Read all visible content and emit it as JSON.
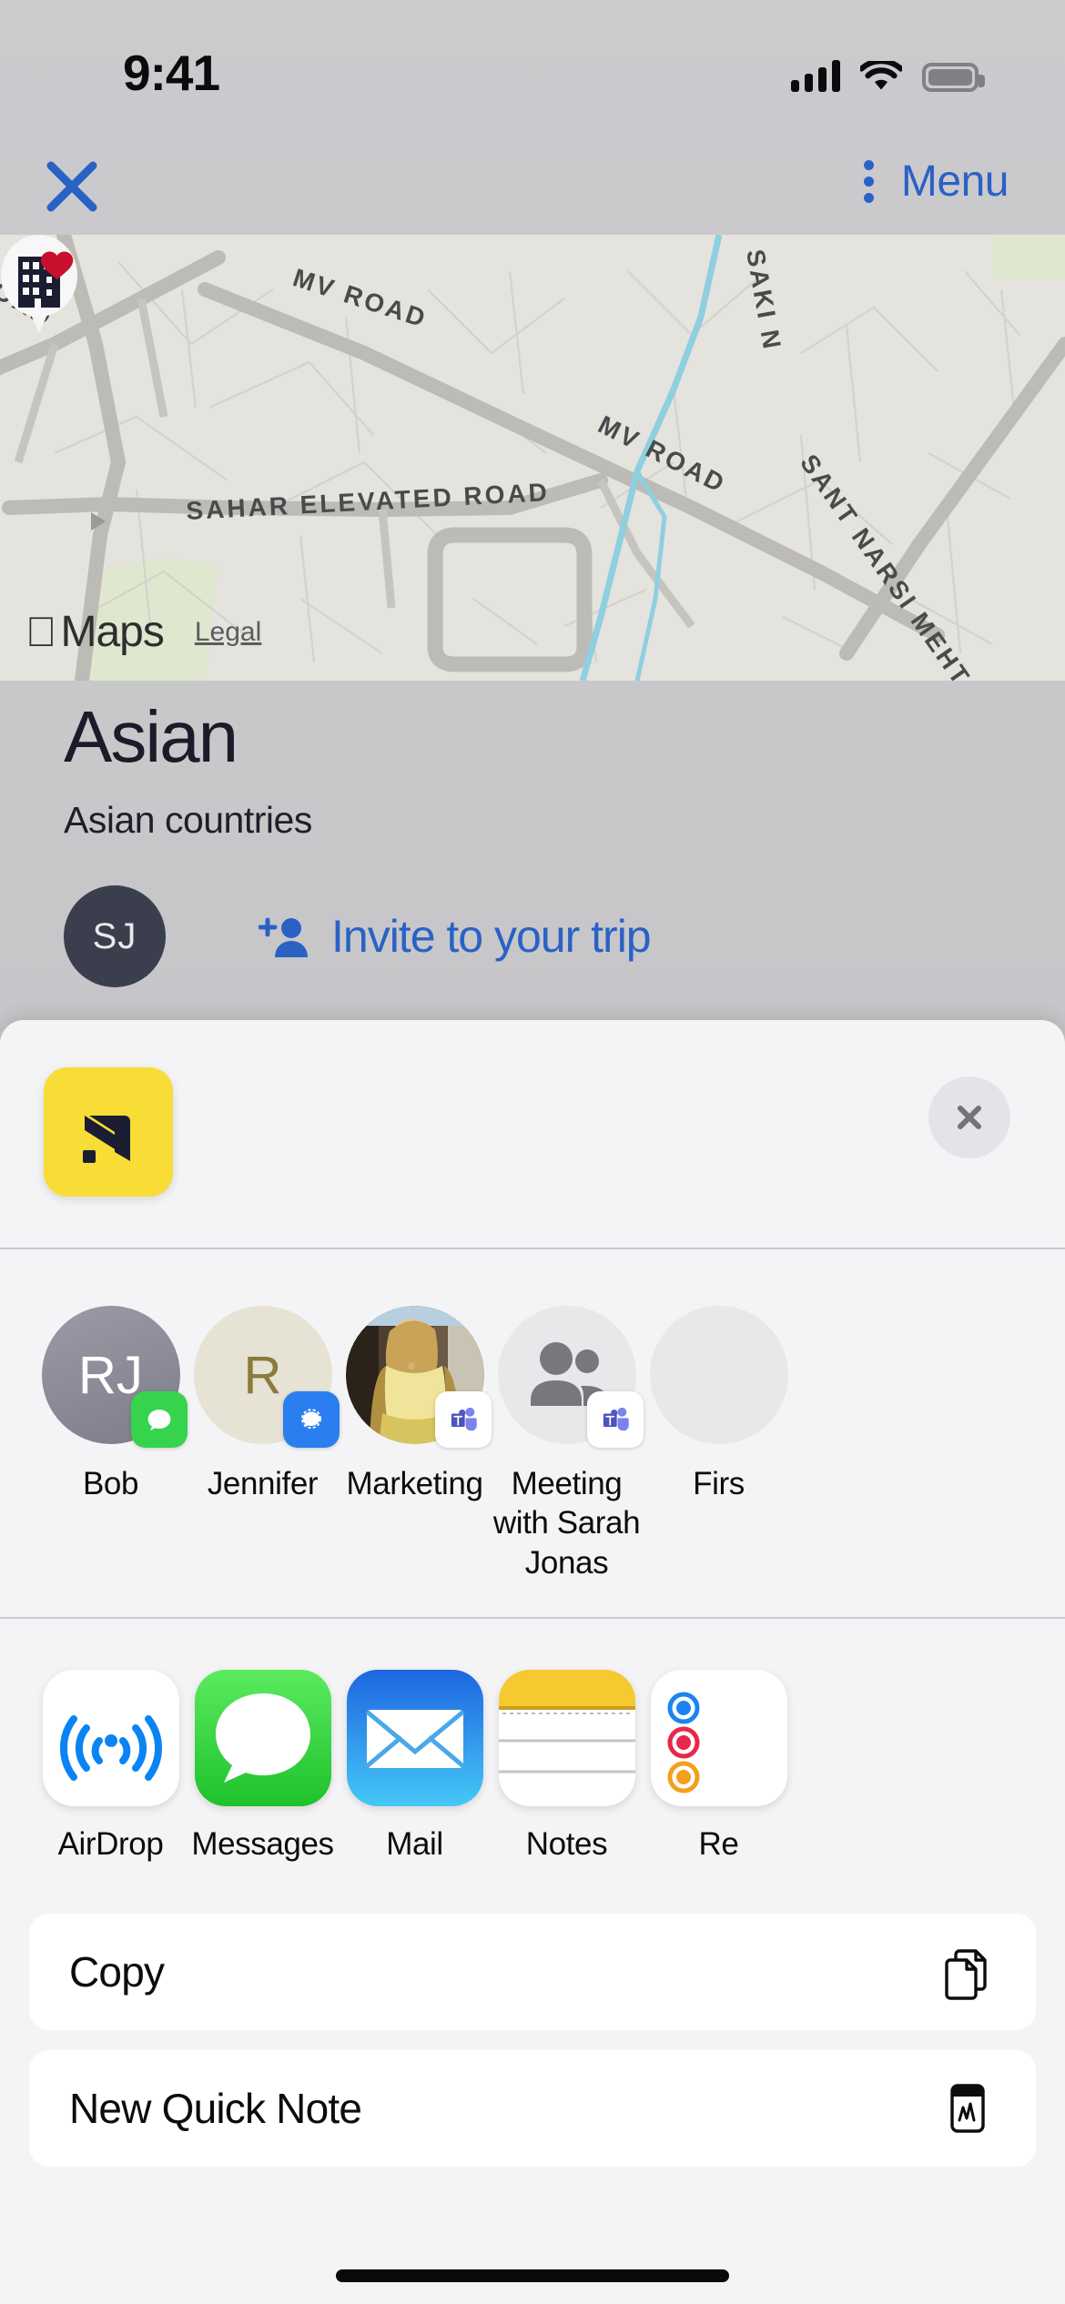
{
  "status_bar": {
    "time": "9:41",
    "icons": [
      "cellular-signal-icon",
      "wifi-icon",
      "battery-icon"
    ],
    "signal_bars": 4,
    "battery_level": 100
  },
  "nav_bar": {
    "close_icon": "close-x-icon",
    "menu_icon": "kebab-menu-icon",
    "menu_label": "Menu",
    "accent_color": "#2a62c4"
  },
  "map": {
    "provider_logo": "apple-logo-icon",
    "provider_name": "Maps",
    "legal_label": "Legal",
    "marker": {
      "icon": "building-icon",
      "favorite_icon": "heart-icon",
      "favorite_color": "#c8102e"
    },
    "labels": [
      "MV ROAD",
      "MV ROAD",
      "SAHAR ELEVATED ROAD",
      "SAKI N",
      "SANT NARSI MEHTA RO",
      "ROAD"
    ],
    "background_color": "#e3e1dc"
  },
  "trip": {
    "title": "Asian",
    "subtitle": "Asian countries",
    "avatar_initials": "SJ",
    "avatar_color": "#3b3f4d",
    "invite_icon": "person-add-icon",
    "invite_label": "Invite to your trip"
  },
  "share_sheet": {
    "app_icon": "yellow-arrow-app-icon",
    "app_icon_color": "#f7dd35",
    "close_icon": "close-circle-icon",
    "contacts": [
      {
        "name": "Bob",
        "initials": "RJ",
        "avatar_color": "#8e8e9a",
        "avatar_type": "initials",
        "badge_icon": "messages-badge-icon",
        "badge_color": "#35d44c"
      },
      {
        "name": "Jennifer",
        "initials": "R",
        "avatar_color": "#e6e3d4",
        "avatar_type": "initials",
        "badge_icon": "signal-badge-icon",
        "badge_color": "#2a7ef0"
      },
      {
        "name": "Marketing",
        "initials": "",
        "avatar_color": "#6a5a46",
        "avatar_type": "photo",
        "badge_icon": "teams-badge-icon",
        "badge_color": "#ffffff"
      },
      {
        "name": "Meeting with Sarah Jonas",
        "initials": "",
        "avatar_color": "#e8e8ea",
        "avatar_type": "group",
        "badge_icon": "teams-badge-icon",
        "badge_color": "#ffffff"
      },
      {
        "name": "Firs",
        "initials": "",
        "avatar_color": "#e8e8ea",
        "avatar_type": "group",
        "badge_icon": "",
        "badge_color": ""
      }
    ],
    "apps": [
      {
        "name": "AirDrop",
        "icon": "airdrop-icon"
      },
      {
        "name": "Messages",
        "icon": "messages-icon"
      },
      {
        "name": "Mail",
        "icon": "mail-icon"
      },
      {
        "name": "Notes",
        "icon": "notes-icon"
      },
      {
        "name": "Re",
        "icon": "reminders-icon"
      }
    ],
    "actions": [
      {
        "label": "Copy",
        "icon": "copy-documents-icon"
      },
      {
        "label": "New Quick Note",
        "icon": "quick-note-icon"
      }
    ]
  }
}
